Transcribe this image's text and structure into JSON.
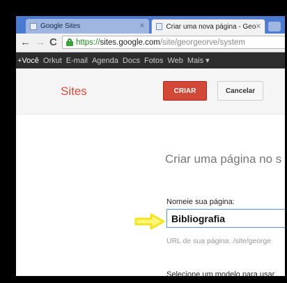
{
  "browser": {
    "tabs": [
      {
        "label": "Google Sites",
        "active": false
      },
      {
        "label": "Criar uma nova página - Georg",
        "active": true
      }
    ],
    "url": {
      "scheme": "https://",
      "host": "sites.google.com",
      "path": "/site/georgeorve/system"
    }
  },
  "gbar": {
    "items": [
      "+Você",
      "Orkut",
      "E-mail",
      "Agenda",
      "Docs",
      "Fotos",
      "Web",
      "Mais ▾"
    ]
  },
  "sites_header": {
    "logo": "Sites",
    "create_label": "CRIAR",
    "cancel_label": "Cancelar"
  },
  "form": {
    "title": "Criar uma página no s",
    "name_label": "Nomeie sua página:",
    "name_value": "Bibliografia",
    "url_hint": "URL de sua página: /site/george",
    "model_label": "Selecione um modelo para usar"
  },
  "colors": {
    "create_button": "#d14836",
    "sites_logo": "#dd4b39",
    "secure_url": "#1f8a1f",
    "arrow": "#f5e320"
  },
  "icons": {
    "arrow": "yellow-right-arrow-icon",
    "lock": "ssl-lock-icon"
  }
}
